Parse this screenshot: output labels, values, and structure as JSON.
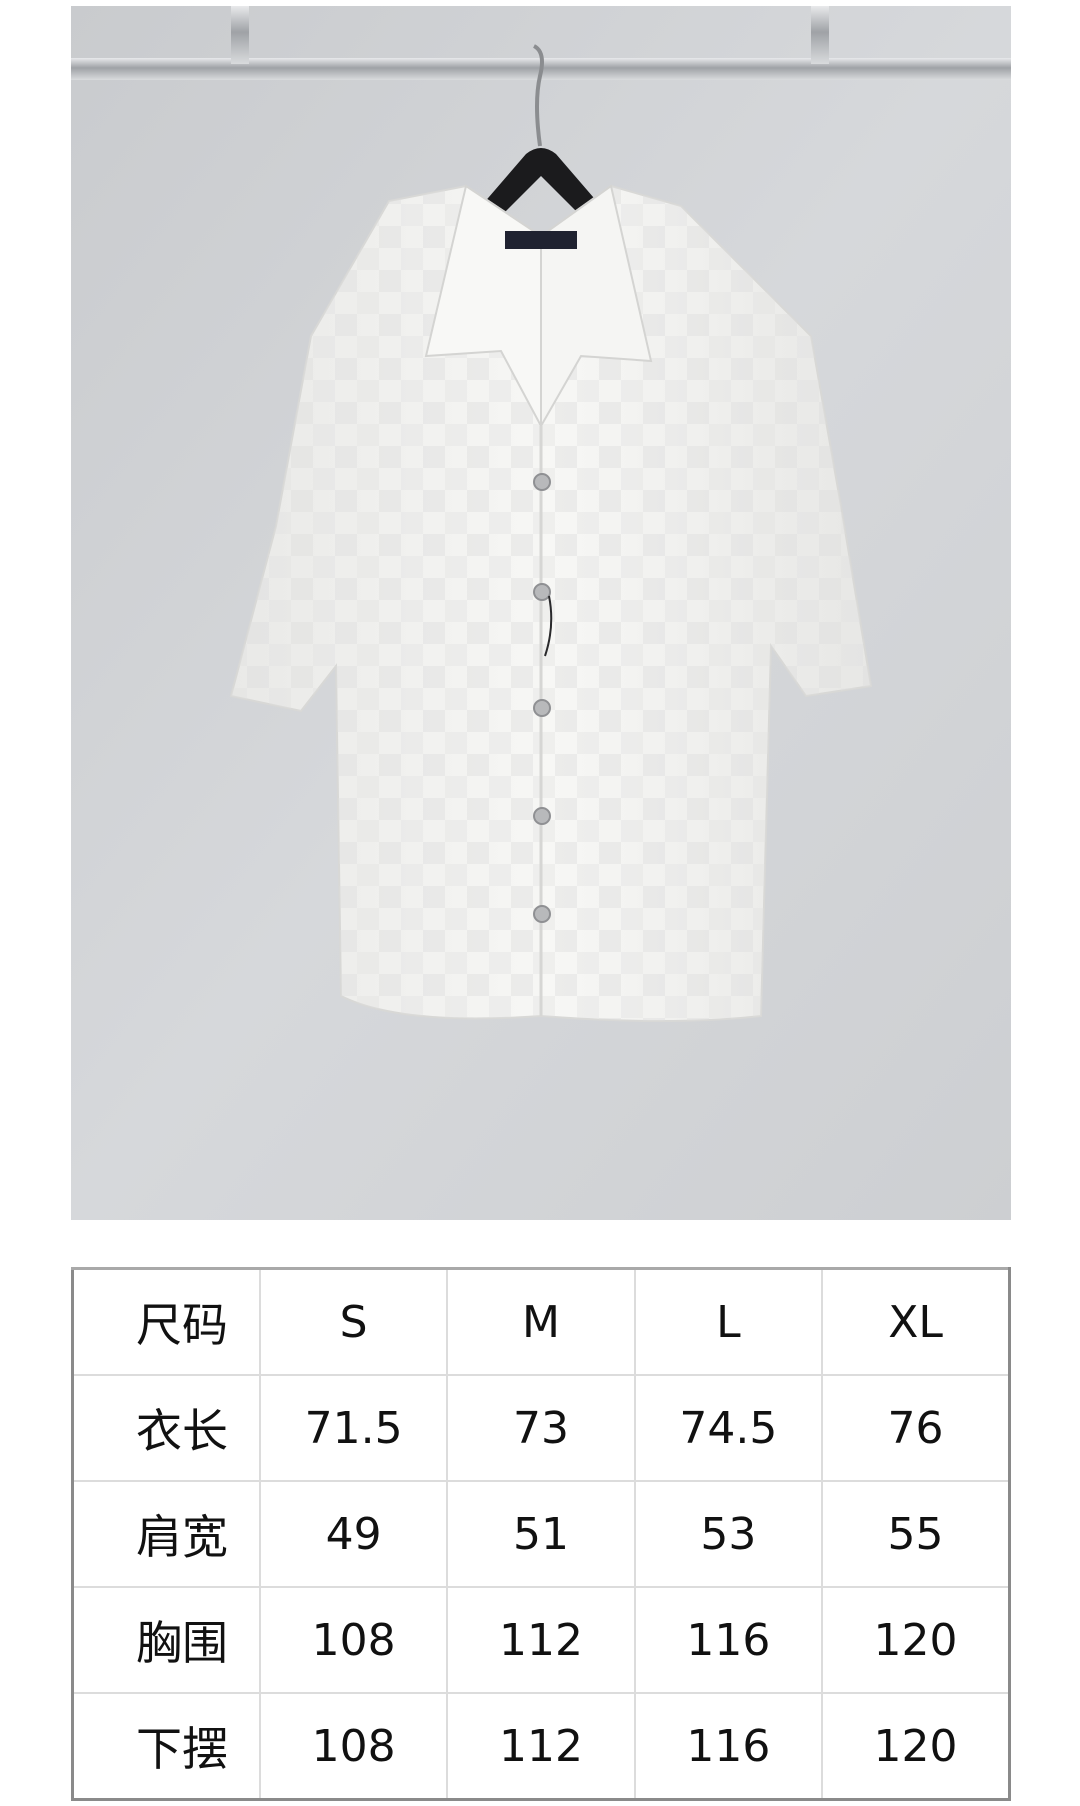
{
  "size_chart": {
    "header": {
      "label": "尺码",
      "sizes": [
        "S",
        "M",
        "L",
        "XL"
      ]
    },
    "rows": [
      {
        "label": "衣长",
        "values": [
          "71.5",
          "73",
          "74.5",
          "76"
        ]
      },
      {
        "label": "肩宽",
        "values": [
          "49",
          "51",
          "53",
          "55"
        ]
      },
      {
        "label": "胸围",
        "values": [
          "108",
          "112",
          "116",
          "120"
        ]
      },
      {
        "label": "下摆",
        "values": [
          "108",
          "112",
          "116",
          "120"
        ]
      }
    ]
  },
  "colors": {
    "wall": "#cfd1d4",
    "shirt": "#f3f3f1",
    "hanger": "#1b1b1d",
    "rail": "#b9bbbe"
  }
}
